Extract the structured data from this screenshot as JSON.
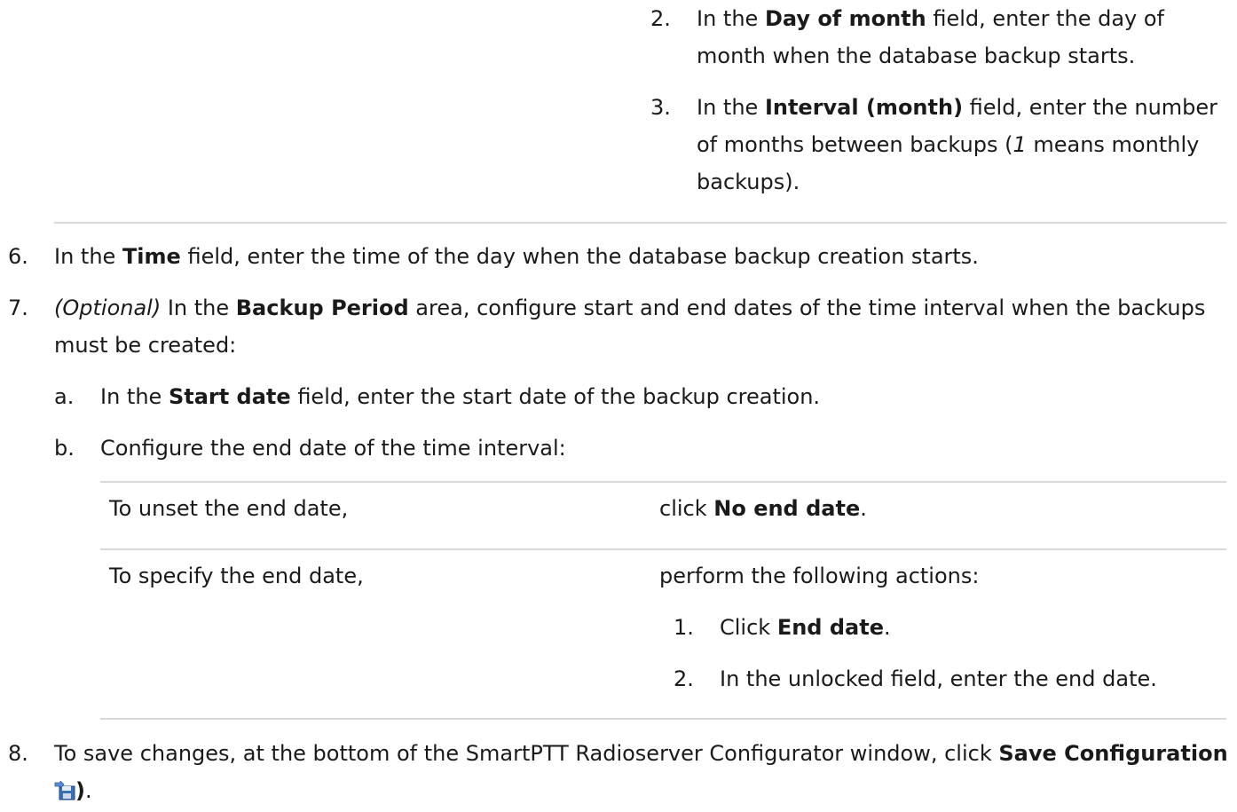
{
  "nested_top": [
    {
      "num": "2.",
      "pre": "In the ",
      "field": "Day of month",
      "post": " field, enter the day of",
      "line2": "month when the database backup starts."
    },
    {
      "num": "3.",
      "pre": "In the ",
      "field": "Interval (month)",
      "post": " field, enter the number",
      "line2_pre": "of months between backups (",
      "line2_em": "1",
      "line2_post": " means monthly",
      "line3": "backups)."
    }
  ],
  "step6": {
    "num": "6.",
    "pre": "In the ",
    "field": "Time",
    "post": " field, enter the time of the day when the database backup creation starts."
  },
  "step7": {
    "num": "7.",
    "optional": "(Optional)",
    "pre": " In the ",
    "area": "Backup Period",
    "post": " area, configure start and end dates of the time interval when the backups",
    "line2": "must be created:"
  },
  "sub_a": {
    "num": "a.",
    "pre": "In the ",
    "field": "Start date",
    "post": " field, enter the start date of the backup creation."
  },
  "sub_b": {
    "num": "b.",
    "text": "Configure the end date of the time interval:"
  },
  "table": {
    "row1": {
      "condition": "To unset the end date,",
      "action_pre": "click ",
      "action_bold": "No end date",
      "action_post": "."
    },
    "row2": {
      "condition": "To specify the end date,",
      "action_intro": "perform the following actions:",
      "steps": [
        {
          "num": "1.",
          "pre": "Click ",
          "bold": "End date",
          "post": "."
        },
        {
          "num": "2.",
          "text": "In the unlocked field, enter the end date."
        }
      ]
    }
  },
  "step8": {
    "num": "8.",
    "pre": "To save changes, at the bottom of the SmartPTT Radioserver Configurator window, click ",
    "bold": "Save Configuration (",
    "icon": "save-configuration-icon",
    "bold_end": ")",
    "post": "."
  }
}
